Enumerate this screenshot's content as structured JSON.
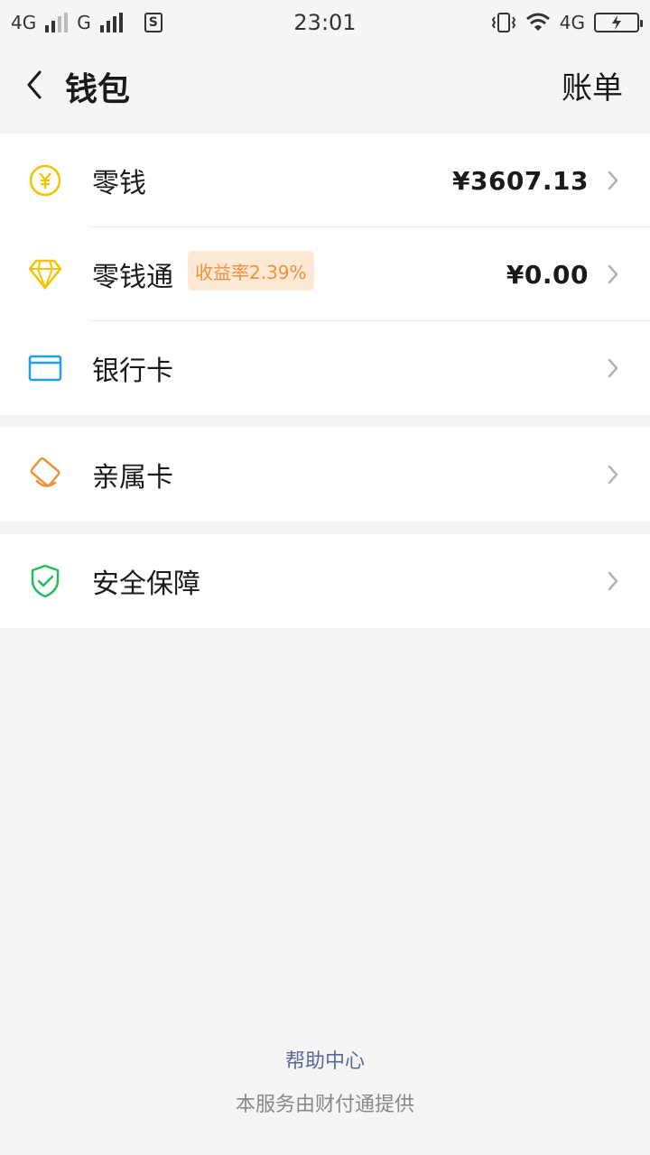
{
  "status_bar": {
    "network_1": "4G",
    "network_2": "G",
    "sim_icon": "S",
    "time": "23:01",
    "network_3": "4G"
  },
  "nav": {
    "title": "钱包",
    "right_label": "账单"
  },
  "wallet": {
    "items": [
      {
        "label": "零钱",
        "amount": "¥3607.13",
        "icon": "yuan-coin-icon"
      },
      {
        "label": "零钱通",
        "badge": "收益率2.39%",
        "amount": "¥0.00",
        "icon": "diamond-icon"
      },
      {
        "label": "银行卡",
        "icon": "bank-card-icon"
      }
    ]
  },
  "family": {
    "label": "亲属卡",
    "icon": "family-card-icon"
  },
  "security": {
    "label": "安全保障",
    "icon": "shield-check-icon"
  },
  "footer": {
    "help_link": "帮助中心",
    "note": "本服务由财付通提供"
  },
  "colors": {
    "coin": "#f5c400",
    "diamond": "#f5c400",
    "card": "#1fa0e8",
    "family": "#f0913a",
    "shield": "#1fbf5a",
    "link": "#576b95",
    "badge_bg": "#fde8d6",
    "badge_text": "#f0913a"
  }
}
